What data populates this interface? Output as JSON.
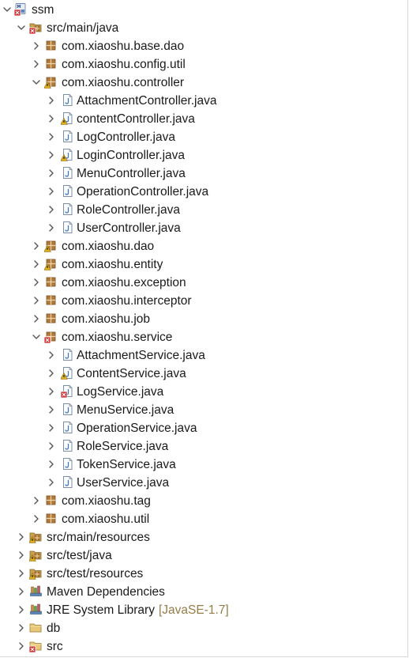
{
  "colors": {
    "package": "#b07a3c",
    "source_folder": "#c8a050",
    "java_file": "#3c78c8",
    "error": "#d03030",
    "warning": "#e0b020",
    "decoration": "#957d47",
    "chevron": "#555555"
  },
  "tree": [
    {
      "label": "ssm",
      "icon": "maven-project-icon",
      "depth": 0,
      "expanded": true,
      "badge": "error"
    },
    {
      "label": "src/main/java",
      "icon": "source-folder-icon",
      "depth": 1,
      "expanded": true,
      "badge": "error"
    },
    {
      "label": "com.xiaoshu.base.dao",
      "icon": "package-icon",
      "depth": 2,
      "expanded": false
    },
    {
      "label": "com.xiaoshu.config.util",
      "icon": "package-icon",
      "depth": 2,
      "expanded": false
    },
    {
      "label": "com.xiaoshu.controller",
      "icon": "package-icon",
      "depth": 2,
      "expanded": true,
      "badge": "warning"
    },
    {
      "label": "AttachmentController.java",
      "icon": "java-file-icon",
      "depth": 3,
      "expanded": false
    },
    {
      "label": "contentController.java",
      "icon": "java-file-icon",
      "depth": 3,
      "expanded": false,
      "badge": "warning"
    },
    {
      "label": "LogController.java",
      "icon": "java-file-icon",
      "depth": 3,
      "expanded": false
    },
    {
      "label": "LoginController.java",
      "icon": "java-file-icon",
      "depth": 3,
      "expanded": false,
      "badge": "warning"
    },
    {
      "label": "MenuController.java",
      "icon": "java-file-icon",
      "depth": 3,
      "expanded": false
    },
    {
      "label": "OperationController.java",
      "icon": "java-file-icon",
      "depth": 3,
      "expanded": false
    },
    {
      "label": "RoleController.java",
      "icon": "java-file-icon",
      "depth": 3,
      "expanded": false
    },
    {
      "label": "UserController.java",
      "icon": "java-file-icon",
      "depth": 3,
      "expanded": false
    },
    {
      "label": "com.xiaoshu.dao",
      "icon": "package-icon",
      "depth": 2,
      "expanded": false,
      "badge": "warning"
    },
    {
      "label": "com.xiaoshu.entity",
      "icon": "package-icon",
      "depth": 2,
      "expanded": false,
      "badge": "warning"
    },
    {
      "label": "com.xiaoshu.exception",
      "icon": "package-icon",
      "depth": 2,
      "expanded": false
    },
    {
      "label": "com.xiaoshu.interceptor",
      "icon": "package-icon",
      "depth": 2,
      "expanded": false
    },
    {
      "label": "com.xiaoshu.job",
      "icon": "package-icon",
      "depth": 2,
      "expanded": false
    },
    {
      "label": "com.xiaoshu.service",
      "icon": "package-icon",
      "depth": 2,
      "expanded": true,
      "badge": "error"
    },
    {
      "label": "AttachmentService.java",
      "icon": "java-file-icon",
      "depth": 3,
      "expanded": false
    },
    {
      "label": "ContentService.java",
      "icon": "java-file-icon",
      "depth": 3,
      "expanded": false,
      "badge": "warning"
    },
    {
      "label": "LogService.java",
      "icon": "java-file-icon",
      "depth": 3,
      "expanded": false,
      "badge": "error"
    },
    {
      "label": "MenuService.java",
      "icon": "java-file-icon",
      "depth": 3,
      "expanded": false
    },
    {
      "label": "OperationService.java",
      "icon": "java-file-icon",
      "depth": 3,
      "expanded": false
    },
    {
      "label": "RoleService.java",
      "icon": "java-file-icon",
      "depth": 3,
      "expanded": false
    },
    {
      "label": "TokenService.java",
      "icon": "java-file-icon",
      "depth": 3,
      "expanded": false
    },
    {
      "label": "UserService.java",
      "icon": "java-file-icon",
      "depth": 3,
      "expanded": false
    },
    {
      "label": "com.xiaoshu.tag",
      "icon": "package-icon",
      "depth": 2,
      "expanded": false
    },
    {
      "label": "com.xiaoshu.util",
      "icon": "package-icon",
      "depth": 2,
      "expanded": false
    },
    {
      "label": "src/main/resources",
      "icon": "source-folder-icon",
      "depth": 1,
      "expanded": false,
      "badge": "warning"
    },
    {
      "label": "src/test/java",
      "icon": "source-folder-icon",
      "depth": 1,
      "expanded": false,
      "badge": "warning"
    },
    {
      "label": "src/test/resources",
      "icon": "source-folder-icon",
      "depth": 1,
      "expanded": false,
      "badge": "warning"
    },
    {
      "label": "Maven Dependencies",
      "icon": "library-icon",
      "depth": 1,
      "expanded": false
    },
    {
      "label": "JRE System Library",
      "decoration": "[JavaSE-1.7]",
      "icon": "library-icon",
      "depth": 1,
      "expanded": false
    },
    {
      "label": "db",
      "icon": "folder-icon",
      "depth": 1,
      "expanded": false
    },
    {
      "label": "src",
      "icon": "folder-icon",
      "depth": 1,
      "expanded": false,
      "badge": "error"
    }
  ]
}
